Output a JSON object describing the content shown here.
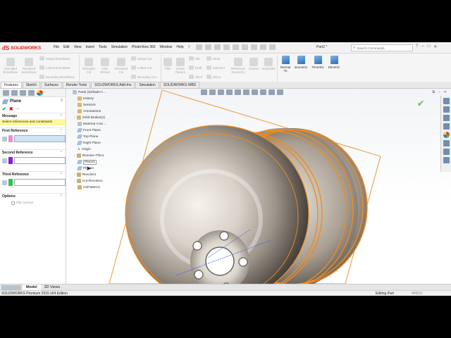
{
  "app": {
    "brand": "SOLIDWORKS",
    "doc_title": "Part2 *",
    "search_placeholder": "Search Commands"
  },
  "menus": [
    "File",
    "Edit",
    "View",
    "Insert",
    "Tools",
    "Simulation",
    "PhotoView 360",
    "Window",
    "Help"
  ],
  "command_manager": {
    "features": [
      {
        "label": "Extruded Boss/Base"
      },
      {
        "label": "Revolved Boss/Base"
      },
      {
        "label": "Extruded Cut"
      },
      {
        "label": "Hole Wizard"
      },
      {
        "label": "Revolved Cut"
      },
      {
        "label": "Fillet"
      },
      {
        "label": "Linear Pattern"
      },
      {
        "label": "Reference Geometry"
      },
      {
        "label": "Curves"
      },
      {
        "label": "Instant3D"
      }
    ],
    "small": [
      "Swept Boss/Base",
      "Lofted Boss/Base",
      "Boundary Boss/Base",
      "Swept Cut",
      "Lofted Cut",
      "Boundary Cut",
      "Rib",
      "Draft",
      "Shell",
      "Wrap",
      "Intersect",
      "Mirror"
    ],
    "views": [
      "Normal To",
      "Isometric",
      "Trimetric",
      "Dimetric"
    ]
  },
  "tabs": [
    "Features",
    "Sketch",
    "Surfaces",
    "Render Tools",
    "SOLIDWORKS Add-Ins",
    "Simulation",
    "SOLIDWORKS MBD"
  ],
  "property_manager": {
    "title": "Plane",
    "help": "?",
    "message_header": "Message",
    "message": "Select references and constraints",
    "refs": [
      {
        "label": "First Reference",
        "color": "#e98fd0",
        "box": "#cfe3f7"
      },
      {
        "label": "Second Reference",
        "color": "#8b1bd1",
        "box": "#ffffff"
      },
      {
        "label": "Third Reference",
        "color": "#33c24d",
        "box": "#ffffff"
      }
    ],
    "options_header": "Options",
    "flip_label": "Flip normal"
  },
  "tree": [
    {
      "label": "Part2  (Default<<...",
      "icon": "part"
    },
    {
      "label": "History",
      "icon": "folder"
    },
    {
      "label": "Sensors",
      "icon": "folder"
    },
    {
      "label": "Annotations",
      "icon": "folder"
    },
    {
      "label": "Solid Bodies(2)",
      "icon": "folder"
    },
    {
      "label": "Material <not ...",
      "icon": "material"
    },
    {
      "label": "Front Plane",
      "icon": "plane"
    },
    {
      "label": "Top Plane",
      "icon": "plane"
    },
    {
      "label": "Right Plane",
      "icon": "plane"
    },
    {
      "label": "Origin",
      "icon": "origin"
    },
    {
      "label": "Revolve-Thin1",
      "icon": "rev"
    },
    {
      "label": "Plane1",
      "icon": "plane"
    },
    {
      "label": "Plane2",
      "icon": "plane"
    },
    {
      "label": "Revolve1",
      "icon": "rev"
    },
    {
      "label": "Cut-Revolve1",
      "icon": "rev"
    },
    {
      "label": "CirPattern1",
      "icon": "rev"
    }
  ],
  "bottom_tabs": [
    "Model",
    "3D Views"
  ],
  "status": {
    "left": "SOLIDWORKS Premium 2016 x64 Edition",
    "right": "Editing Part",
    "units": "MMGS"
  },
  "colors": {
    "accent": "#e2231a",
    "highlight": "#f08c1c",
    "message_bg": "#fff89a"
  }
}
